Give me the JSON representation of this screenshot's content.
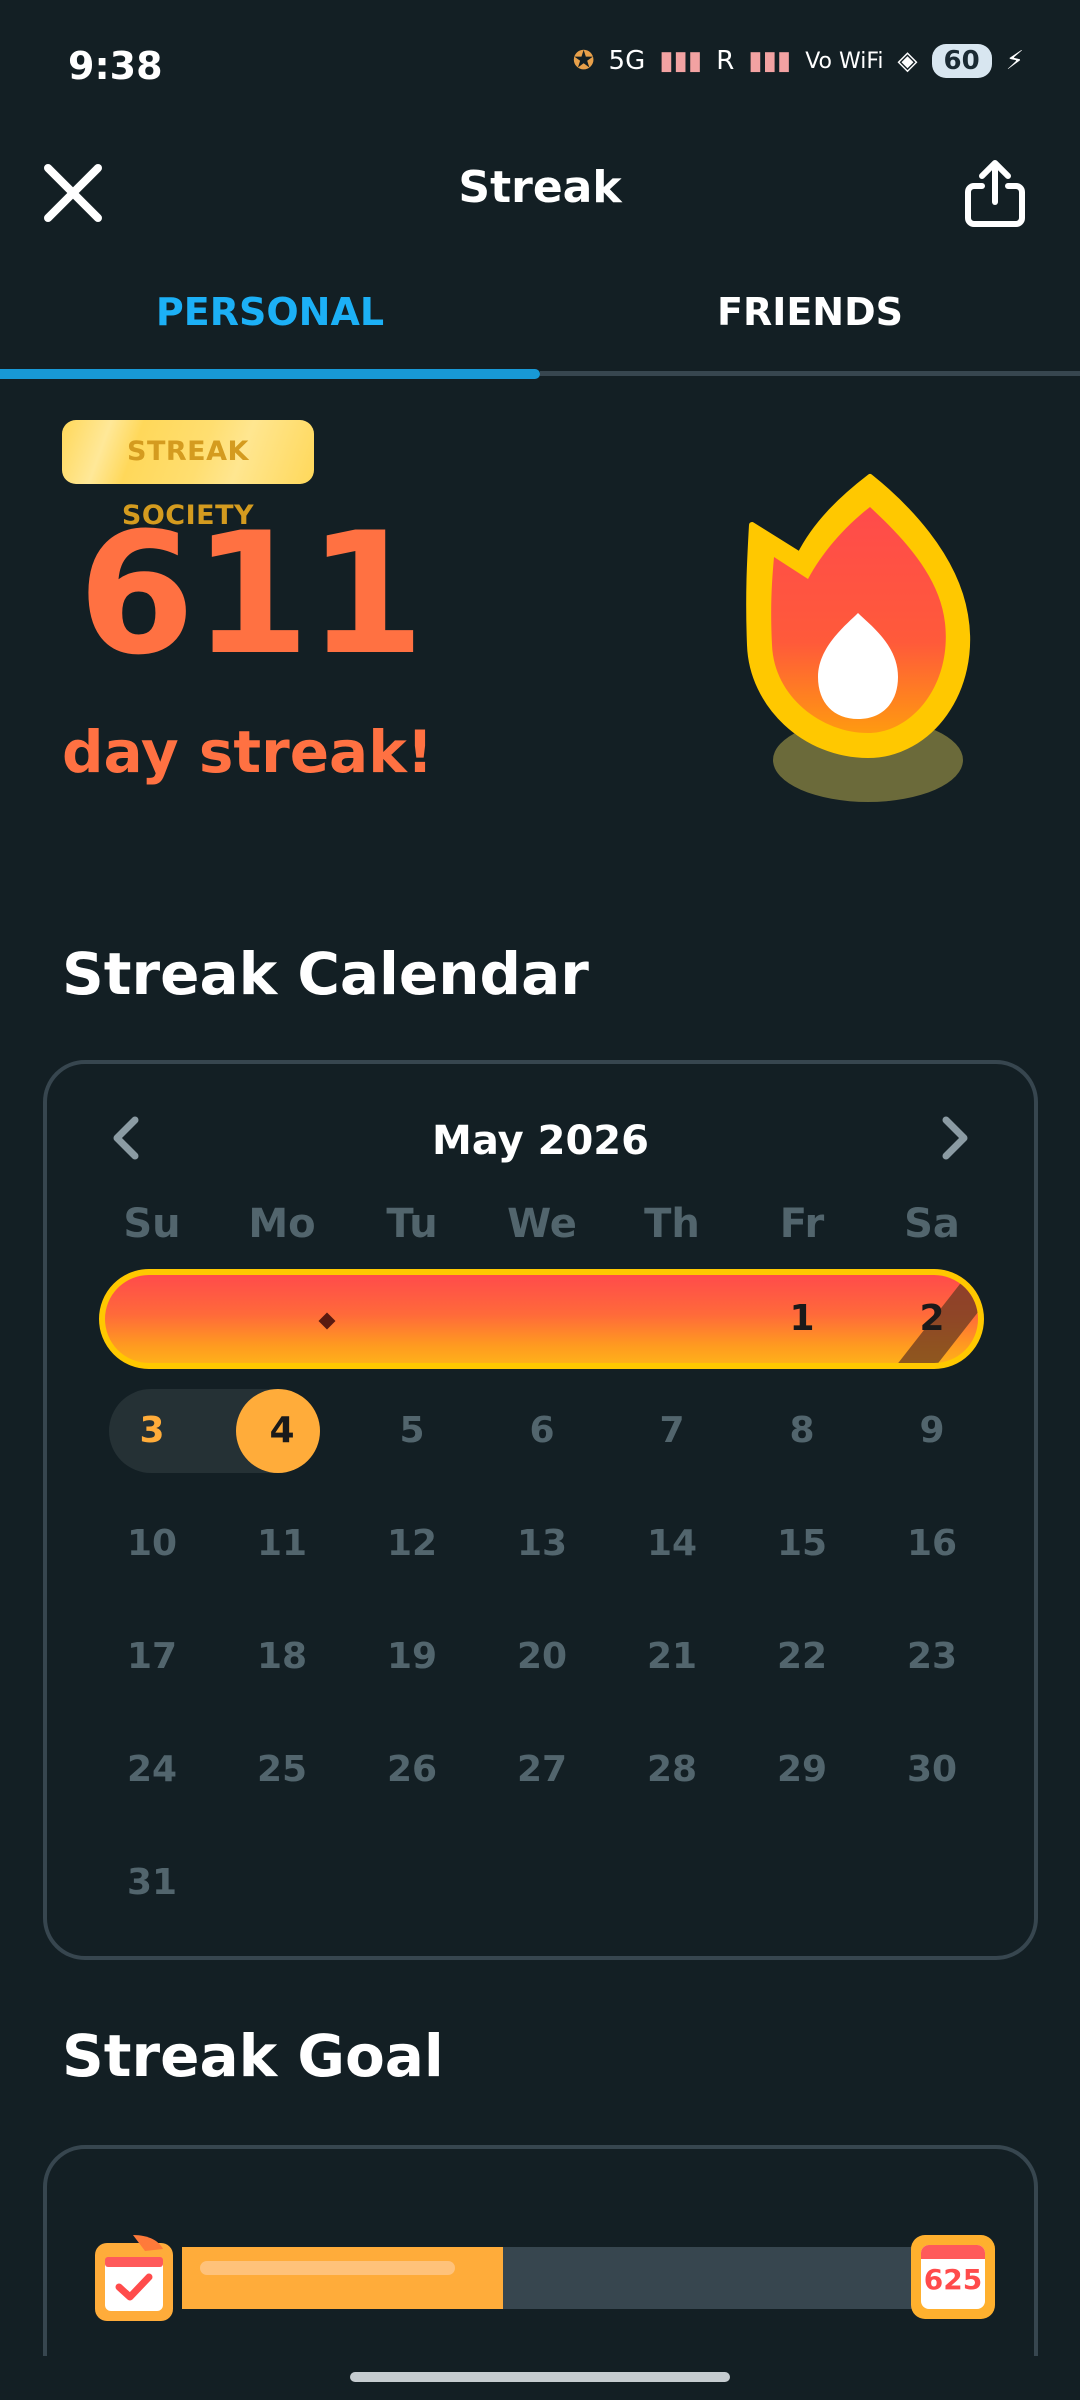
{
  "status_bar": {
    "time": "9:38",
    "network_labels": [
      "5G",
      "R",
      "Vo WiFi"
    ],
    "battery": "60"
  },
  "header": {
    "title": "Streak",
    "close_icon": "close-icon",
    "share_icon": "share-icon"
  },
  "tabs": [
    {
      "label": "PERSONAL",
      "active": true
    },
    {
      "label": "FRIENDS",
      "active": false
    }
  ],
  "hero": {
    "badge": "STREAK SOCIETY",
    "count": "611",
    "label": "day streak!",
    "flame_icon": "streak-flame-icon"
  },
  "calendar": {
    "section_title": "Streak Calendar",
    "month": "May 2026",
    "weekdays": [
      "Su",
      "Mo",
      "Tu",
      "We",
      "Th",
      "Fr",
      "Sa"
    ],
    "days": [
      "1",
      "2",
      "3",
      "4",
      "5",
      "6",
      "7",
      "8",
      "9",
      "10",
      "11",
      "12",
      "13",
      "14",
      "15",
      "16",
      "17",
      "18",
      "19",
      "20",
      "21",
      "22",
      "23",
      "24",
      "25",
      "26",
      "27",
      "28",
      "29",
      "30",
      "31"
    ],
    "today": "4",
    "colors": {
      "streak_border": "#ffc800",
      "streak_top": "#ff4b4b",
      "streak_bottom": "#ffb01a",
      "today": "#ffac3a",
      "inactive": "#52656d"
    }
  },
  "goal": {
    "section_title": "Streak Goal",
    "target": "625",
    "progress_fraction": 0.44,
    "start_icon": "calendar-check-icon",
    "end_icon": "calendar-goal-icon"
  }
}
